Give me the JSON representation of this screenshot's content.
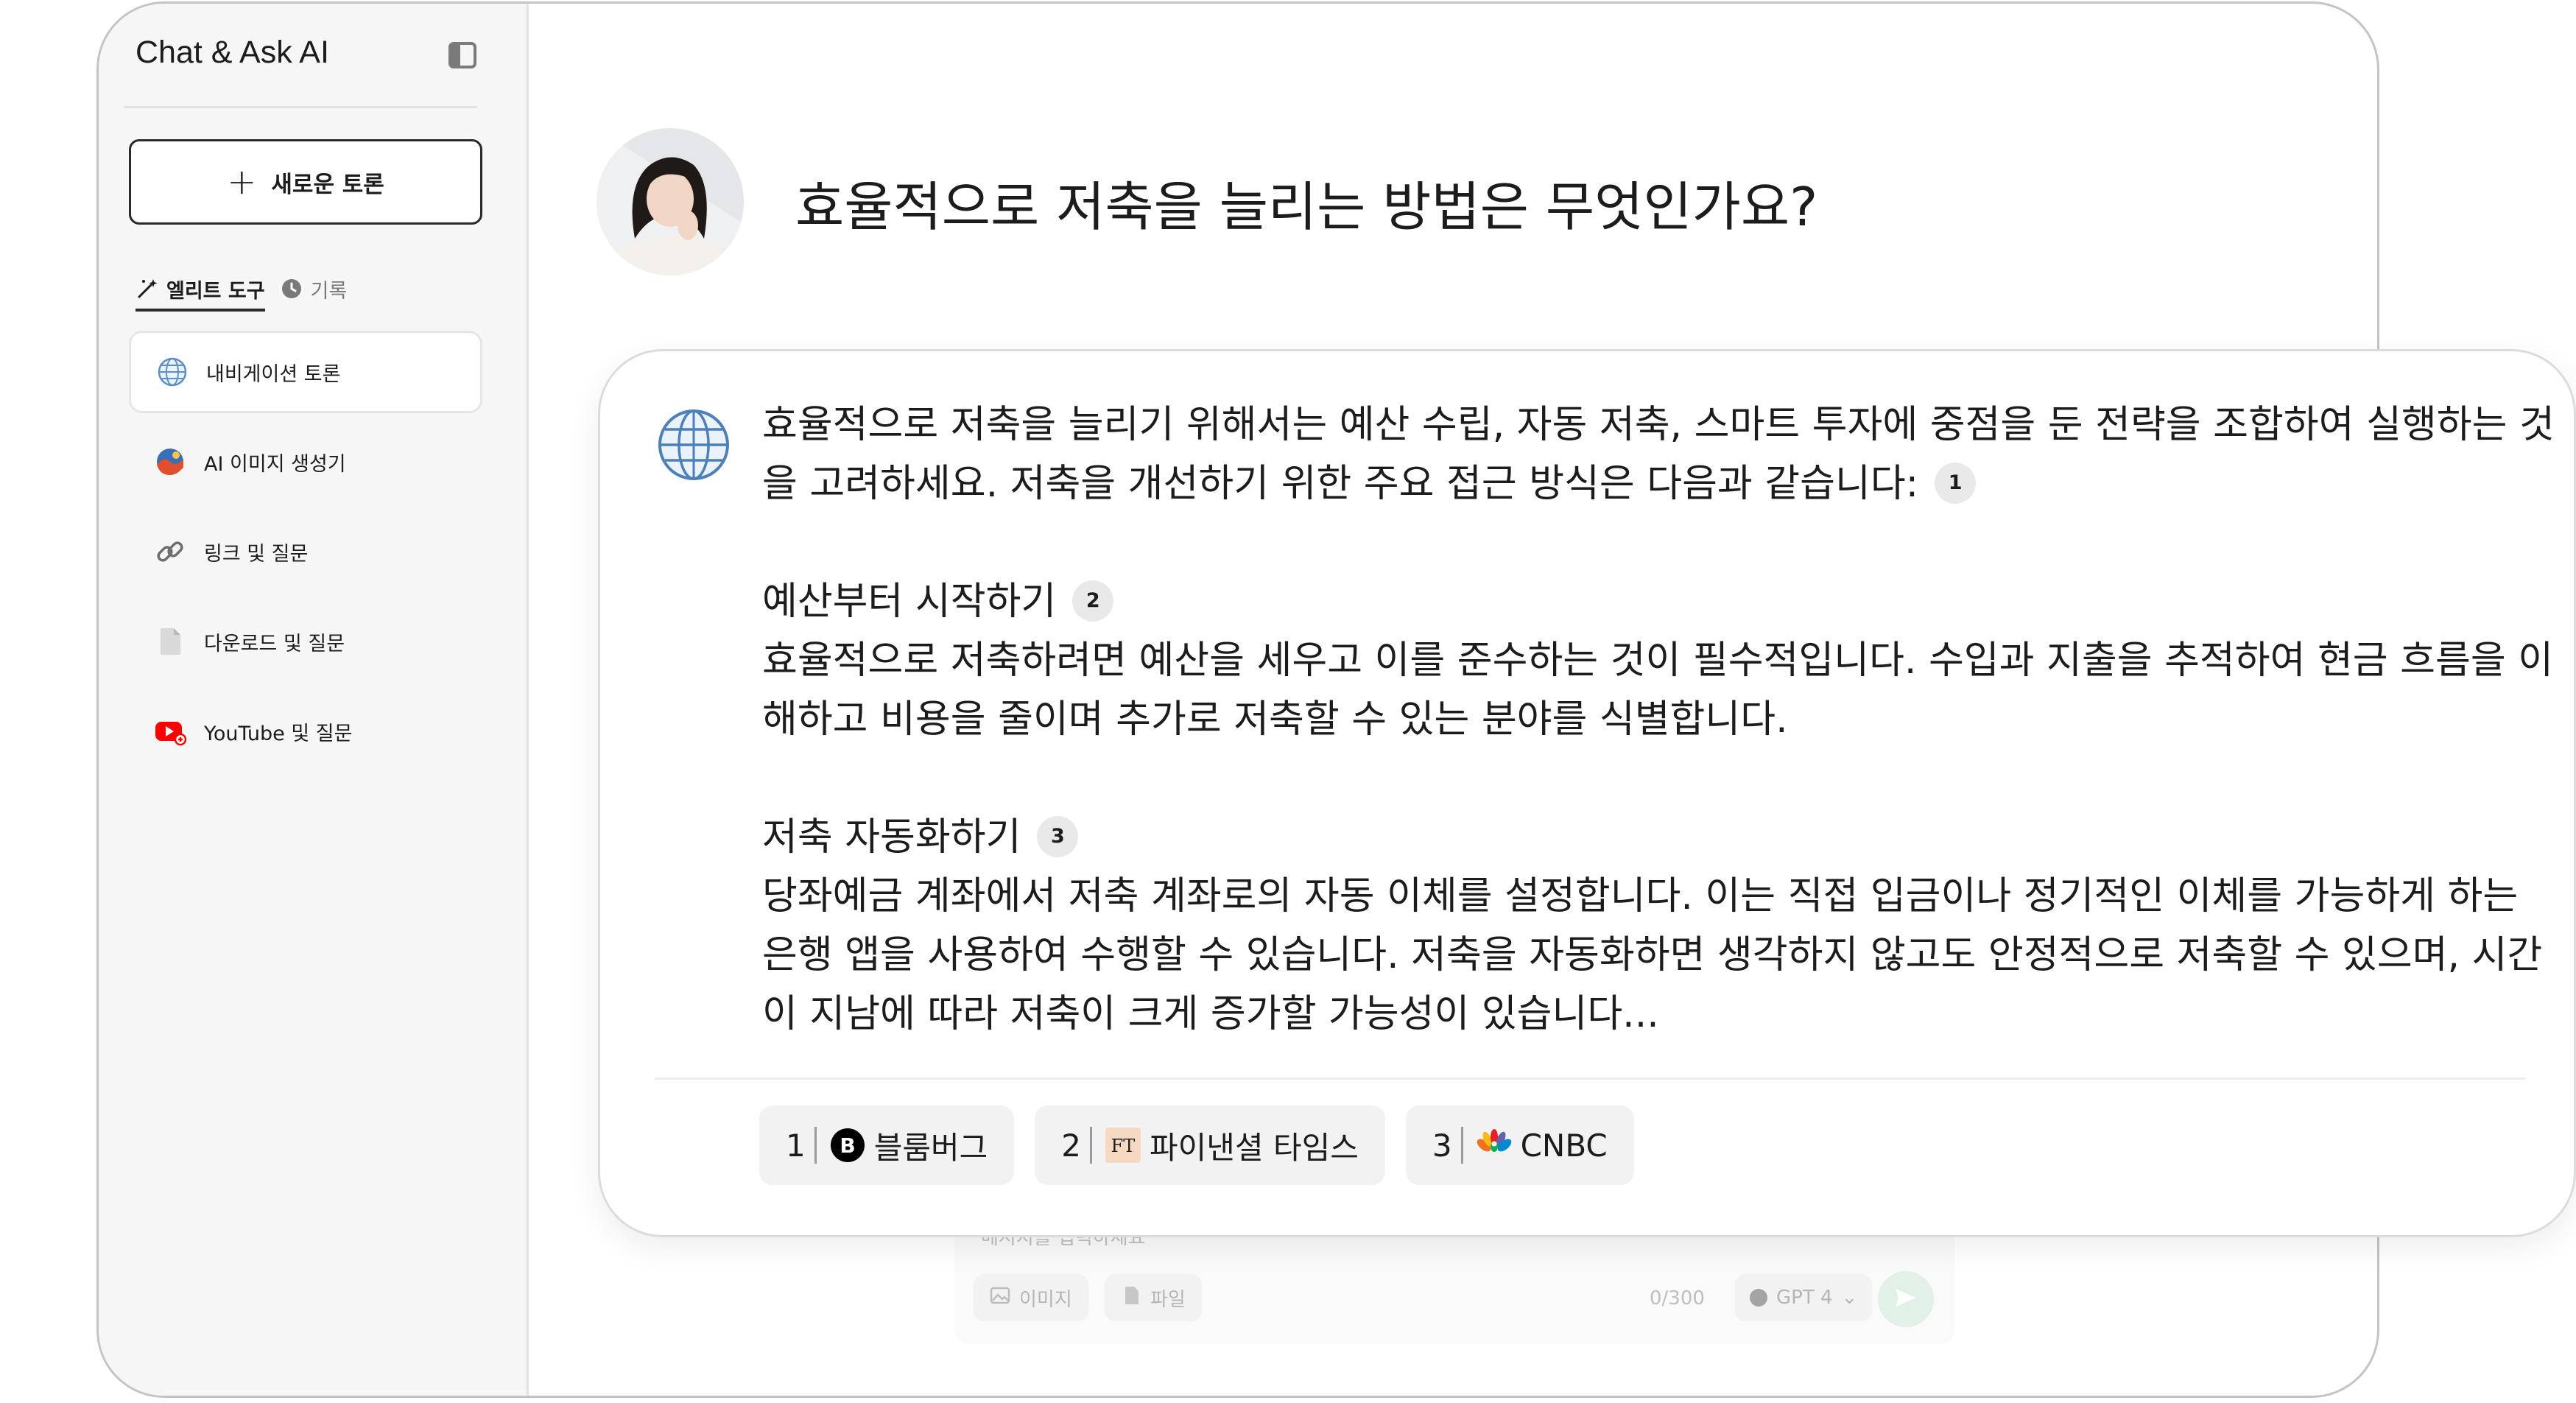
{
  "sidebar": {
    "app_title": "Chat & Ask AI",
    "new_chat_label": "새로운 토론",
    "tabs": [
      {
        "label": "엘리트 도구",
        "icon": "magic-wand-icon"
      },
      {
        "label": "기록",
        "icon": "clock-icon"
      }
    ],
    "items": [
      {
        "label": "내비게이션 토론",
        "icon": "globe-icon"
      },
      {
        "label": "AI 이미지 생성기",
        "icon": "image-generator-icon"
      },
      {
        "label": "링크 및 질문",
        "icon": "link-icon"
      },
      {
        "label": "다운로드 및 질문",
        "icon": "document-icon"
      },
      {
        "label": "YouTube 및 질문",
        "icon": "youtube-icon"
      }
    ]
  },
  "question": "효율적으로 저축을 늘리는 방법은 무엇인가요?",
  "answer": {
    "intro": "효율적으로 저축을 늘리기 위해서는 예산 수립, 자동 저축, 스마트 투자에 중점을 둔 전략을 조합하여 실행하는 것을 고려하세요. 저축을 개선하기 위한 주요 접근 방식은 다음과 같습니다:",
    "intro_cite": "1",
    "section1_title": "예산부터 시작하기",
    "section1_cite": "2",
    "section1_body": "효율적으로 저축하려면 예산을 세우고 이를 준수하는 것이 필수적입니다. 수입과 지출을 추적하여 현금 흐름을 이해하고 비용을 줄이며 추가로 저축할 수 있는 분야를 식별합니다.",
    "section2_title": "저축 자동화하기",
    "section2_cite": "3",
    "section2_body": "당좌예금 계좌에서 저축 계좌로의 자동 이체를 설정합니다. 이는 직접 입금이나 정기적인 이체를 가능하게 하는 은행 앱을 사용하여 수행할 수 있습니다. 저축을 자동화하면 생각하지 않고도 안정적으로 저축할 수 있으며, 시간이 지남에 따라 저축이 크게 증가할 가능성이 있습니다..."
  },
  "sources": [
    {
      "num": "1",
      "name": "블룸버그",
      "logo": "bloomberg-logo",
      "logo_text": "B",
      "color": "#000000"
    },
    {
      "num": "2",
      "name": "파이낸셜 타임스",
      "logo": "financial-times-logo",
      "logo_text": "FT",
      "color": "#f2dfce"
    },
    {
      "num": "3",
      "name": "CNBC",
      "logo": "cnbc-logo",
      "logo_text": "CNBC",
      "color": "#0089d0"
    }
  ],
  "composer": {
    "placeholder": "메시지를 입력하세요",
    "image_label": "이미지",
    "file_label": "파일",
    "counter": "0/300",
    "model": "GPT 4"
  },
  "colors": {
    "send": "#c9e7d4",
    "youtube": "#ff0000"
  }
}
